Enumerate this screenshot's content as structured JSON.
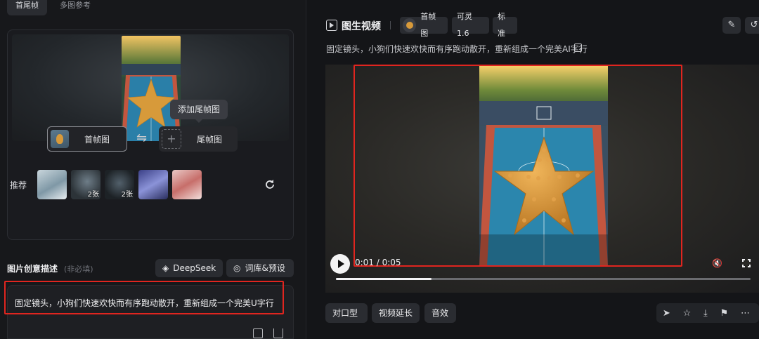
{
  "left": {
    "tabs": [
      {
        "label": "首尾帧",
        "active": true
      },
      {
        "label": "多图参考",
        "active": false
      }
    ],
    "tooltip": "添加尾帧图",
    "first_frame_label": "首帧图",
    "last_frame_label": "尾帧图",
    "swap_symbol": "⇋",
    "plus_symbol": "+",
    "recommend_label": "推荐",
    "recommend_items": [
      {
        "count": ""
      },
      {
        "count": "2张"
      },
      {
        "count": "2张"
      },
      {
        "count": ""
      },
      {
        "count": ""
      }
    ],
    "description_title": "图片创意描述",
    "description_hint": "(非必填)",
    "deepseek_label": "DeepSeek",
    "library_label": "词库&预设",
    "description_text": "固定镜头，小狗们快速欢快而有序跑动散开，重新组成一个完美U字行"
  },
  "right": {
    "title": "图生视频",
    "chips": [
      "首帧图",
      "可灵 1.6",
      "标准"
    ],
    "prompt": "固定镜头，小狗们快速欢快而有序跑动散开，重新组成一个完美AI字行",
    "player": {
      "timecode": "0:01 / 0:05",
      "progress": 0.23
    },
    "action_buttons": [
      "对口型",
      "视频延长",
      "音效"
    ],
    "icon_actions": [
      "send-icon",
      "star-icon",
      "download-icon",
      "flag-icon",
      "more-icon"
    ]
  },
  "colors": {
    "highlight_red": "#e0251f",
    "panel_bg": "#17181b",
    "button_bg": "#2a2c31"
  }
}
